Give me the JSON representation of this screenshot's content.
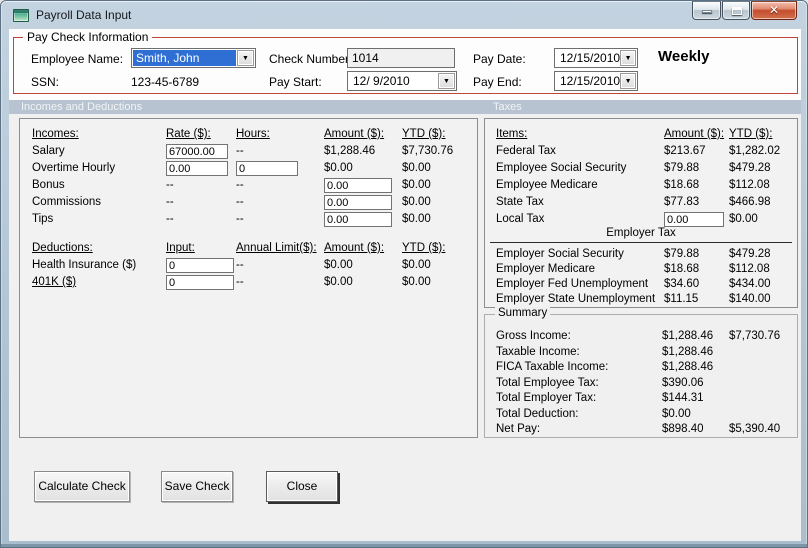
{
  "colors": {
    "group_border": "#c0443c",
    "section_strip": "#b7c3d0",
    "selection_blue": "#2f6fd3",
    "close_button_red": "#c44d2d"
  },
  "icons": {
    "dropdown": "▼",
    "close": "✕"
  },
  "window": {
    "title": "Payroll Data Input"
  },
  "sections": {
    "incomes_deductions": "Incomes and Deductions",
    "taxes": "Taxes"
  },
  "paycheck": {
    "legend": "Pay Check Information",
    "employee_name_label": "Employee Name:",
    "employee_name": "Smith, John",
    "ssn_label": "SSN:",
    "ssn": "123-45-6789",
    "check_number_label": "Check Number:",
    "check_number": "1014",
    "pay_start_label": "Pay Start:",
    "pay_start": "12/ 9/2010",
    "pay_date_label": "Pay Date:",
    "pay_date": "12/15/2010",
    "pay_end_label": "Pay End:",
    "pay_end": "12/15/2010",
    "frequency": "Weekly"
  },
  "incomes": {
    "headers": [
      "Incomes:",
      "Rate ($):",
      "Hours:",
      "Amount ($):",
      "YTD ($):"
    ],
    "rows": [
      {
        "label": "Salary",
        "cells": [
          {
            "t": "input",
            "v": "67000.00"
          },
          {
            "t": "text",
            "v": "--"
          },
          {
            "t": "text",
            "v": "$1,288.46"
          },
          {
            "t": "text",
            "v": "$7,730.76"
          }
        ]
      },
      {
        "label": "Overtime Hourly",
        "cells": [
          {
            "t": "input",
            "v": "0.00"
          },
          {
            "t": "input",
            "v": "0"
          },
          {
            "t": "text",
            "v": "$0.00"
          },
          {
            "t": "text",
            "v": "$0.00"
          }
        ]
      },
      {
        "label": "Bonus",
        "cells": [
          {
            "t": "text",
            "v": "--"
          },
          {
            "t": "text",
            "v": "--"
          },
          {
            "t": "input",
            "v": "0.00"
          },
          {
            "t": "text",
            "v": "$0.00"
          }
        ]
      },
      {
        "label": "Commissions",
        "cells": [
          {
            "t": "text",
            "v": "--"
          },
          {
            "t": "text",
            "v": "--"
          },
          {
            "t": "input",
            "v": "0.00"
          },
          {
            "t": "text",
            "v": "$0.00"
          }
        ]
      },
      {
        "label": "Tips",
        "cells": [
          {
            "t": "text",
            "v": "--"
          },
          {
            "t": "text",
            "v": "--"
          },
          {
            "t": "input",
            "v": "0.00"
          },
          {
            "t": "text",
            "v": "$0.00"
          }
        ]
      }
    ]
  },
  "deductions": {
    "headers": [
      "Deductions:",
      "Input:",
      "Annual Limit($):",
      "Amount ($):",
      "YTD ($):"
    ],
    "rows": [
      {
        "label": "Health Insurance  ($)",
        "underline": false,
        "cells": [
          {
            "t": "input",
            "v": "0"
          },
          {
            "t": "text",
            "v": "--"
          },
          {
            "t": "text",
            "v": "$0.00"
          },
          {
            "t": "text",
            "v": "$0.00"
          }
        ]
      },
      {
        "label": "401K  ($)",
        "underline": true,
        "cells": [
          {
            "t": "input",
            "v": "0"
          },
          {
            "t": "text",
            "v": "--"
          },
          {
            "t": "text",
            "v": "$0.00"
          },
          {
            "t": "text",
            "v": "$0.00"
          }
        ]
      }
    ]
  },
  "taxes": {
    "headers": [
      "Items:",
      "Amount ($):",
      "YTD ($):"
    ],
    "employee_rows": [
      {
        "label": "Federal Tax",
        "cells": [
          {
            "t": "text",
            "v": "$213.67"
          },
          {
            "t": "text",
            "v": "$1,282.02"
          }
        ]
      },
      {
        "label": "Employee Social Security",
        "cells": [
          {
            "t": "text",
            "v": "$79.88"
          },
          {
            "t": "text",
            "v": "$479.28"
          }
        ]
      },
      {
        "label": "Employee Medicare",
        "cells": [
          {
            "t": "text",
            "v": "$18.68"
          },
          {
            "t": "text",
            "v": "$112.08"
          }
        ]
      },
      {
        "label": "State Tax",
        "cells": [
          {
            "t": "text",
            "v": "$77.83"
          },
          {
            "t": "text",
            "v": "$466.98"
          }
        ]
      },
      {
        "label": "Local Tax",
        "cells": [
          {
            "t": "input",
            "v": "0.00"
          },
          {
            "t": "text",
            "v": "$0.00"
          }
        ]
      }
    ],
    "employer_group_label": "Employer Tax",
    "employer_rows": [
      {
        "label": "Employer Social Security",
        "cells": [
          {
            "t": "text",
            "v": "$79.88"
          },
          {
            "t": "text",
            "v": "$479.28"
          }
        ]
      },
      {
        "label": "Employer Medicare",
        "cells": [
          {
            "t": "text",
            "v": "$18.68"
          },
          {
            "t": "text",
            "v": "$112.08"
          }
        ]
      },
      {
        "label": "Employer Fed Unemployment",
        "cells": [
          {
            "t": "text",
            "v": "$34.60"
          },
          {
            "t": "text",
            "v": "$434.00"
          }
        ]
      },
      {
        "label": "Employer State Unemployment",
        "cells": [
          {
            "t": "text",
            "v": "$11.15"
          },
          {
            "t": "text",
            "v": "$140.00"
          }
        ]
      }
    ]
  },
  "summary": {
    "legend": "Summary",
    "rows": [
      {
        "label": "Gross Income:",
        "amount": "$1,288.46",
        "ytd": "$7,730.76"
      },
      {
        "label": "Taxable Income:",
        "amount": "$1,288.46",
        "ytd": ""
      },
      {
        "label": "FICA Taxable Income:",
        "amount": "$1,288.46",
        "ytd": ""
      },
      {
        "label": "Total Employee Tax:",
        "amount": "$390.06",
        "ytd": ""
      },
      {
        "label": "Total Employer Tax:",
        "amount": "$144.31",
        "ytd": ""
      },
      {
        "label": "Total Deduction:",
        "amount": "$0.00",
        "ytd": ""
      },
      {
        "label": "Net Pay:",
        "amount": "$898.40",
        "ytd": "$5,390.40"
      }
    ]
  },
  "buttons": {
    "calculate": "Calculate Check",
    "save": "Save Check",
    "close": "Close"
  }
}
